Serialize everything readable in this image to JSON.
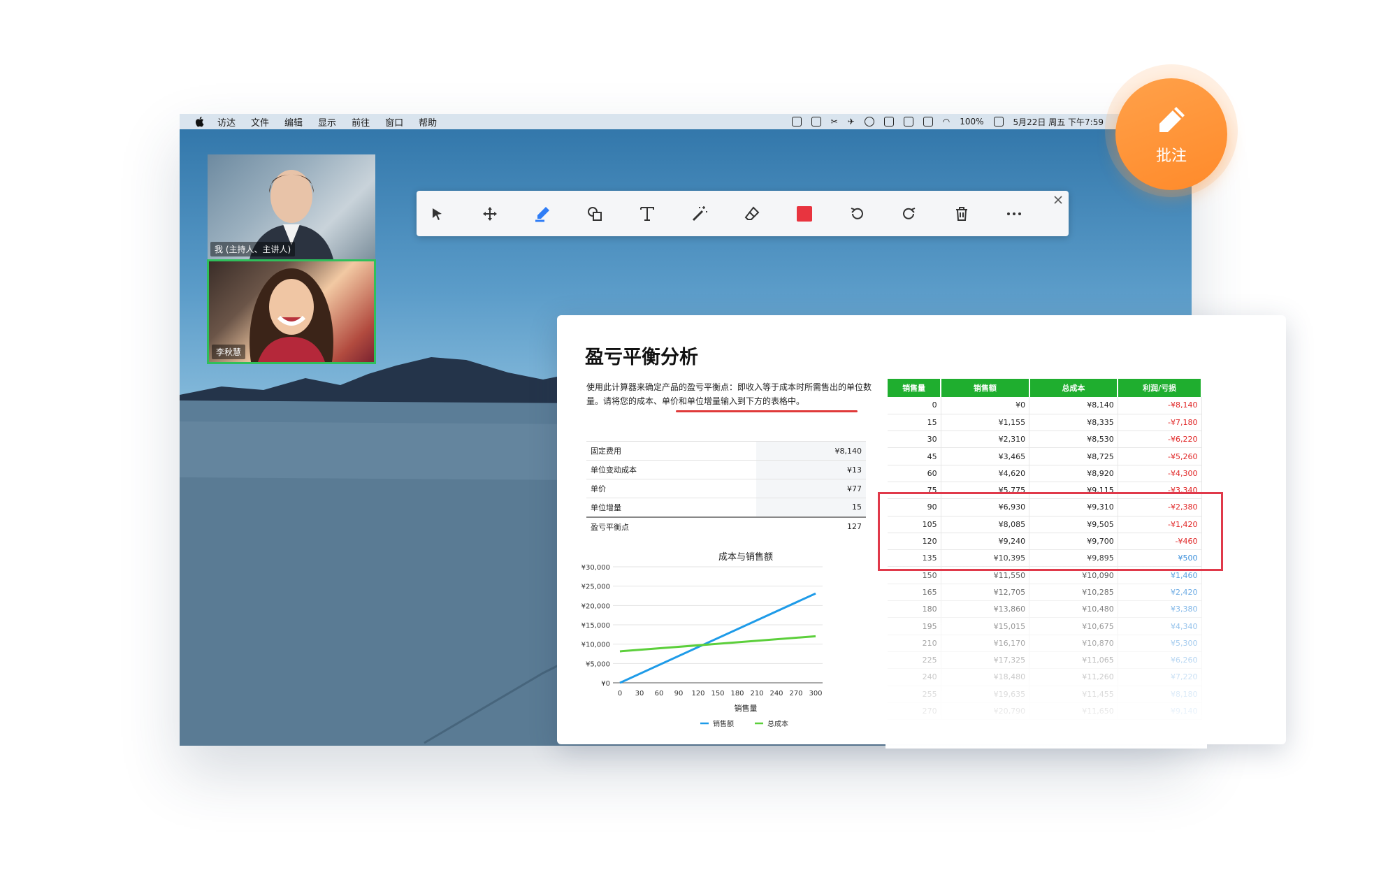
{
  "menubar": {
    "items": [
      "访达",
      "文件",
      "编辑",
      "显示",
      "前往",
      "窗口",
      "帮助"
    ],
    "battery": "100%",
    "datetime": "5月22日 周五 下午7:59"
  },
  "videos": {
    "host_label": "我 (主持人、主讲人)",
    "guest_label": "李秋慧"
  },
  "toolbar": {
    "tools": [
      "select",
      "move",
      "pen",
      "shape",
      "text",
      "magic-wand",
      "eraser",
      "color",
      "undo",
      "redo",
      "delete",
      "more"
    ],
    "color": "#e8343f"
  },
  "annotate_badge": {
    "label": "批注"
  },
  "sheet": {
    "title": "盈亏平衡分析",
    "description": "使用此计算器来确定产品的盈亏平衡点：即收入等于成本时所需售出的单位数量。请将您的成本、单价和单位增量输入到下方的表格中。",
    "inputs": [
      {
        "label": "固定费用",
        "value": "¥8,140"
      },
      {
        "label": "单位变动成本",
        "value": "¥13"
      },
      {
        "label": "单价",
        "value": "¥77"
      },
      {
        "label": "单位增量",
        "value": "15"
      },
      {
        "label": "盈亏平衡点",
        "value": "127"
      }
    ],
    "table": {
      "headers": [
        "销售量",
        "销售额",
        "总成本",
        "利润/亏损"
      ],
      "rows": [
        [
          "0",
          "¥0",
          "¥8,140",
          "-¥8,140"
        ],
        [
          "15",
          "¥1,155",
          "¥8,335",
          "-¥7,180"
        ],
        [
          "30",
          "¥2,310",
          "¥8,530",
          "-¥6,220"
        ],
        [
          "45",
          "¥3,465",
          "¥8,725",
          "-¥5,260"
        ],
        [
          "60",
          "¥4,620",
          "¥8,920",
          "-¥4,300"
        ],
        [
          "75",
          "¥5,775",
          "¥9,115",
          "-¥3,340"
        ],
        [
          "90",
          "¥6,930",
          "¥9,310",
          "-¥2,380"
        ],
        [
          "105",
          "¥8,085",
          "¥9,505",
          "-¥1,420"
        ],
        [
          "120",
          "¥9,240",
          "¥9,700",
          "-¥460"
        ],
        [
          "135",
          "¥10,395",
          "¥9,895",
          "¥500"
        ],
        [
          "150",
          "¥11,550",
          "¥10,090",
          "¥1,460"
        ],
        [
          "165",
          "¥12,705",
          "¥10,285",
          "¥2,420"
        ],
        [
          "180",
          "¥13,860",
          "¥10,480",
          "¥3,380"
        ],
        [
          "195",
          "¥15,015",
          "¥10,675",
          "¥4,340"
        ],
        [
          "210",
          "¥16,170",
          "¥10,870",
          "¥5,300"
        ],
        [
          "225",
          "¥17,325",
          "¥11,065",
          "¥6,260"
        ],
        [
          "240",
          "¥18,480",
          "¥11,260",
          "¥7,220"
        ],
        [
          "255",
          "¥19,635",
          "¥11,455",
          "¥8,180"
        ],
        [
          "270",
          "¥20,790",
          "¥11,650",
          "¥9,140"
        ]
      ]
    }
  },
  "chart_data": {
    "type": "line",
    "title": "成本与销售额",
    "xlabel": "销售量",
    "ylabel": "",
    "x": [
      0,
      300
    ],
    "xticks": [
      "0",
      "30",
      "60",
      "90",
      "120",
      "150",
      "180",
      "210",
      "240",
      "270",
      "300"
    ],
    "yticks": [
      "¥0",
      "¥5,000",
      "¥10,000",
      "¥15,000",
      "¥20,000",
      "¥25,000",
      "¥30,000"
    ],
    "xlim": [
      0,
      300
    ],
    "ylim": [
      0,
      30000
    ],
    "series": [
      {
        "name": "销售额",
        "color": "#1e9be8",
        "values": [
          0,
          23100
        ]
      },
      {
        "name": "总成本",
        "color": "#5ccf3b",
        "values": [
          8140,
          12040
        ]
      }
    ],
    "legend": "bottom",
    "grid": true
  }
}
